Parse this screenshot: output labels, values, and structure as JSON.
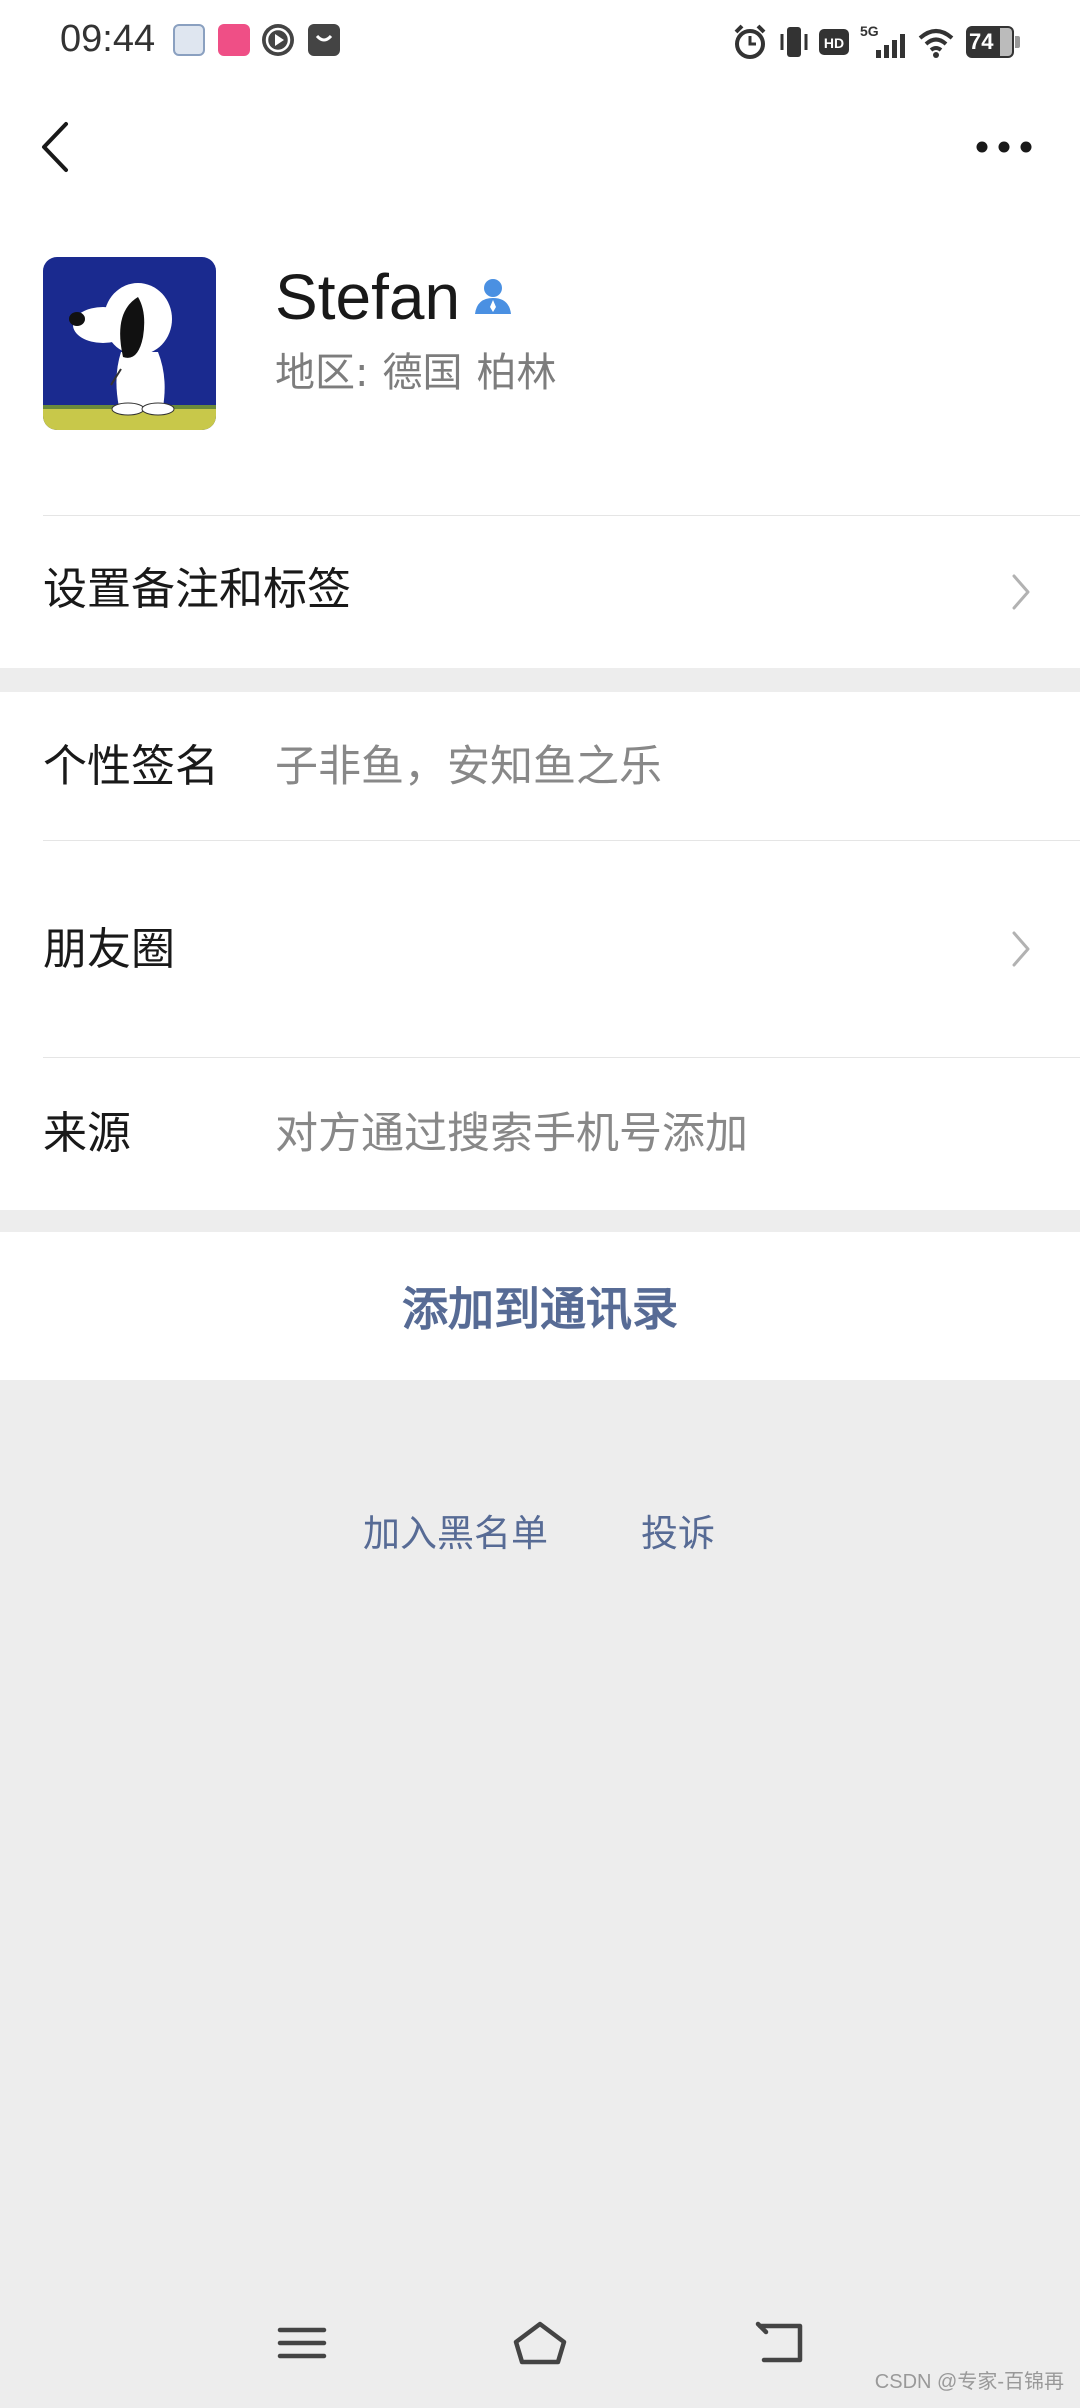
{
  "status_bar": {
    "time": "09:44",
    "battery": "74",
    "network": "5G",
    "hd": "HD"
  },
  "nav": {
    "back_icon": "chevron-left",
    "more_icon": "ellipsis"
  },
  "profile": {
    "name": "Stefan",
    "region_label": "地区:",
    "region_country": "德国",
    "region_city": "柏林"
  },
  "rows": {
    "remark": "设置备注和标签",
    "signature_label": "个性签名",
    "signature_value": "子非鱼，安知鱼之乐",
    "moments_label": "朋友圈",
    "source_label": "来源",
    "source_value": "对方通过搜索手机号添加"
  },
  "actions": {
    "add_contact": "添加到通讯录",
    "blacklist": "加入黑名单",
    "report": "投诉"
  },
  "watermark": "CSDN @专家-百锦再",
  "colors": {
    "link": "#576b95",
    "background": "#ededed",
    "card": "#ffffff"
  }
}
